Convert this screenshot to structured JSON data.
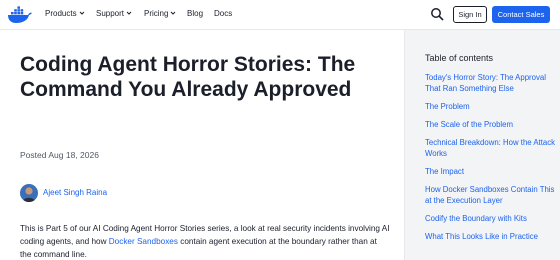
{
  "nav": {
    "logo": "docker-logo",
    "menu": [
      {
        "label": "Products",
        "dropdown": true
      },
      {
        "label": "Support",
        "dropdown": true
      },
      {
        "label": "Pricing",
        "dropdown": true
      },
      {
        "label": "Blog",
        "dropdown": false
      },
      {
        "label": "Docs",
        "dropdown": false
      }
    ],
    "sign_in": "Sign In",
    "contact_sales": "Contact Sales"
  },
  "article": {
    "title": "Coding Agent Horror Stories: The Command You Already Approved",
    "posted": "Posted Aug 18, 2026",
    "author": "Ajeet Singh Raina",
    "intro_before": "This is Part 5 of our AI Coding Agent Horror Stories series, a look at real security incidents involving AI coding agents, and how ",
    "intro_link": "Docker Sandboxes",
    "intro_after": " contain agent execution at the boundary rather than at the command line."
  },
  "toc": {
    "title": "Table of contents",
    "items": [
      "Today's Horror Story: The Approval That Ran Something Else",
      "The Problem",
      "The Scale of the Problem",
      "Technical Breakdown: How the Attack Works",
      "The Impact",
      "How Docker Sandboxes Contain This at the Execution Layer",
      "Codify the Boundary with Kits",
      "What This Looks Like in Practice"
    ]
  },
  "colors": {
    "brand_blue": "#1d63ed",
    "text": "#1b1f2a",
    "sidebar_bg": "#f3f4f6"
  }
}
